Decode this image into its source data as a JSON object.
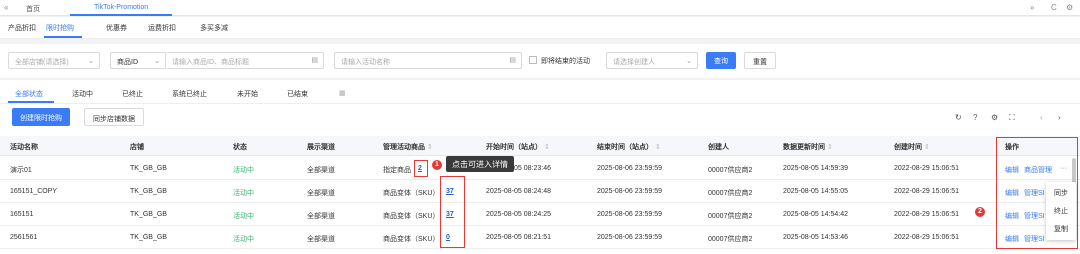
{
  "topbar": {
    "nav_left": "«",
    "home": "首页",
    "active_tab": "TikTok-Promotion",
    "nav_right": "»",
    "refresh": "C",
    "settings": "⚙"
  },
  "promo_tabs": [
    "产品折扣",
    "限时抢购",
    "优惠券",
    "运费折扣",
    "多买多减"
  ],
  "filters": {
    "store_placeholder": "全部店铺(请选择)",
    "product_id_select": "商品ID",
    "product_id_placeholder": "请输入商品ID、商品标题",
    "activity_placeholder": "请输入活动名称",
    "ending_soon_label": "即将结束的活动",
    "creator_placeholder": "请选择创建人",
    "query_button": "查询",
    "reset_button": "重置"
  },
  "status_tabs": [
    "全部状态",
    "活动中",
    "已终止",
    "系统已终止",
    "未开始",
    "已结束"
  ],
  "actions": {
    "create_button": "创建限时抢购",
    "sync_button": "同步店铺数据"
  },
  "table": {
    "headers": [
      "活动名称",
      "店铺",
      "状态",
      "展示渠道",
      "管理活动商品",
      "开始时间（站点）",
      "结束时间（站点）",
      "创建人",
      "数据更新时间",
      "创建时间",
      "操作"
    ],
    "rows": [
      {
        "name": "演示01",
        "store": "TK_GB_GB",
        "status": "活动中",
        "channel": "全部渠道",
        "goods_label": "指定商品",
        "goods_count": "2",
        "start": "2025-08-05 08:23:46",
        "end": "2025-08-06 23:59:59",
        "creator": "00007供应商2",
        "updated": "2025-08-05 14:59:39",
        "created": "2022-08-29 15:06:51",
        "op_edit": "编辑",
        "op_manage": "商品管理",
        "op_more": "···"
      },
      {
        "name": "165151_COPY",
        "store": "TK_GB_GB",
        "status": "活动中",
        "channel": "全部渠道",
        "goods_label": "商品变体（SKU）",
        "goods_count": "37",
        "start": "2025-08-05 08:24:48",
        "end": "2025-08-06 23:59:59",
        "creator": "00007供应商2",
        "updated": "2025-08-05 14:55:05",
        "created": "2022-08-29 15:06:51",
        "op_edit": "编辑",
        "op_manage": "管理SI"
      },
      {
        "name": "165151",
        "store": "TK_GB_GB",
        "status": "活动中",
        "channel": "全部渠道",
        "goods_label": "商品变体（SKU）",
        "goods_count": "37",
        "start": "2025-08-05 08:24:25",
        "end": "2025-08-06 23:59:59",
        "creator": "00007供应商2",
        "updated": "2025-08-05 14:54:42",
        "created": "2022-08-29 15:06:51",
        "op_edit": "编辑",
        "op_manage": "管理SI"
      },
      {
        "name": "2561561",
        "store": "TK_GB_GB",
        "status": "活动中",
        "channel": "全部渠道",
        "goods_label": "商品变体（SKU）",
        "goods_count": "0",
        "start": "2025-08-05 08:21:51",
        "end": "2025-08-06 23:59:59",
        "creator": "00007供应商2",
        "updated": "2025-08-05 14:53:46",
        "created": "2022-08-29 15:06:51",
        "op_edit": "编辑",
        "op_manage": "管理SI"
      }
    ]
  },
  "more_menu": [
    "同步",
    "终止",
    "复制"
  ],
  "annotations": {
    "badge1": "1",
    "badge2": "2",
    "tooltip": "点击可进入详情"
  },
  "colors": {
    "accent": "#3a7bf6",
    "active_status": "#3cb371",
    "annotation": "#e53935"
  }
}
